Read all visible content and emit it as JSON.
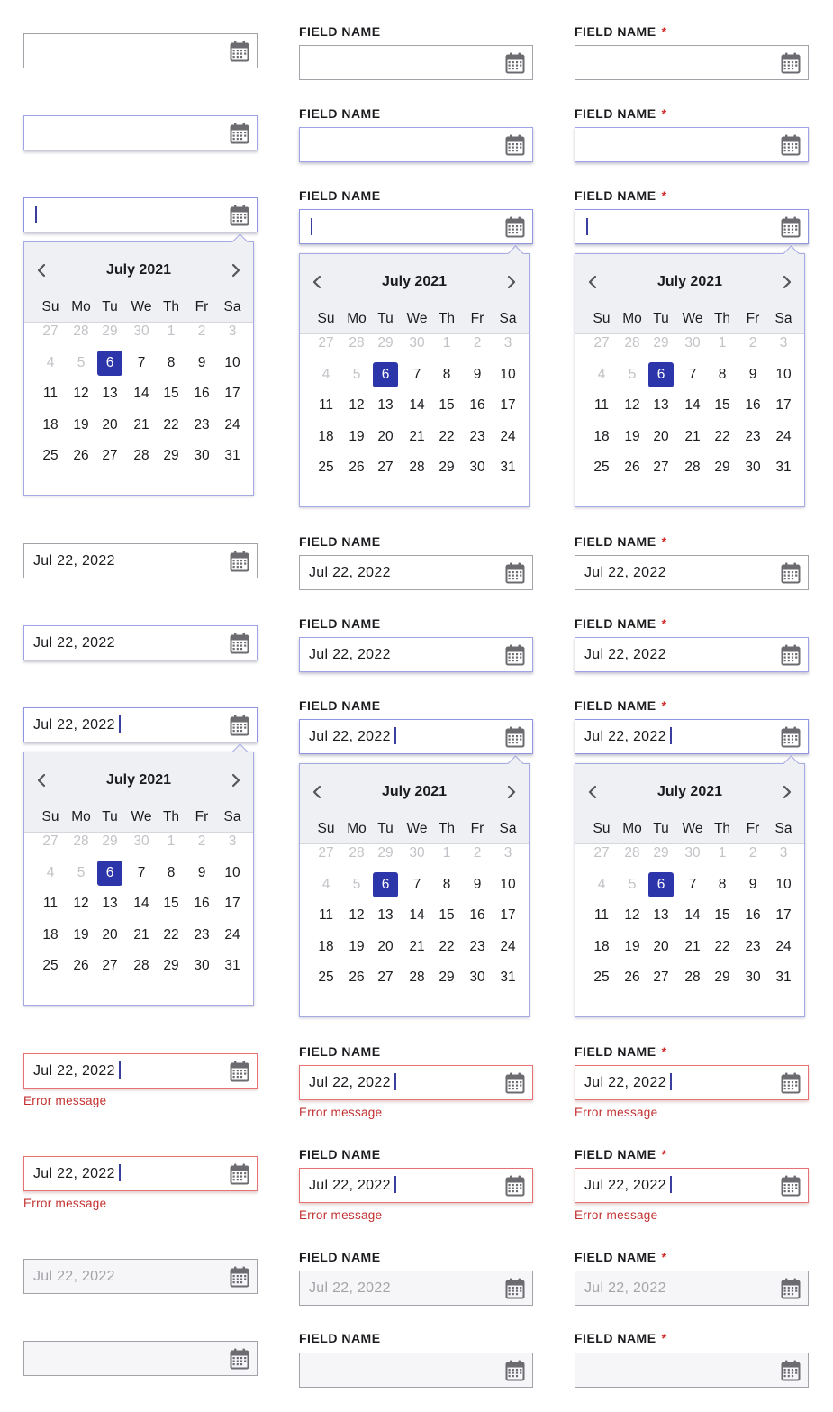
{
  "label": "FIELD NAME",
  "required_mark": "*",
  "date_value": "Jul 22, 2022",
  "error_message": "Error message",
  "calendar": {
    "month_label": "July 2021",
    "weekdays": [
      "Su",
      "Mo",
      "Tu",
      "We",
      "Th",
      "Fr",
      "Sa"
    ],
    "weeks": [
      [
        "27",
        "28",
        "29",
        "30",
        "1",
        "2",
        "3"
      ],
      [
        "4",
        "5",
        "6",
        "7",
        "8",
        "9",
        "10"
      ],
      [
        "11",
        "12",
        "13",
        "14",
        "15",
        "16",
        "17"
      ],
      [
        "18",
        "19",
        "20",
        "21",
        "22",
        "23",
        "24"
      ],
      [
        "25",
        "26",
        "27",
        "28",
        "29",
        "30",
        "31"
      ]
    ],
    "muted_days": [
      "27",
      "28",
      "29",
      "30",
      "1",
      "2",
      "3",
      "4",
      "5"
    ],
    "selected_day": "6"
  },
  "colors": {
    "accent": "#2d35ab",
    "focus_border": "#8f95e0",
    "error": "#c23030",
    "required": "#d62b2b",
    "disabled_bg": "#f6f6f8"
  },
  "icons": {
    "field": "calendar-icon",
    "prev": "chevron-left-icon",
    "next": "chevron-right-icon"
  },
  "rows": [
    {
      "state": "default",
      "value": "",
      "caret": false,
      "error": false,
      "picker": false
    },
    {
      "state": "hover",
      "value": "",
      "caret": false,
      "error": false,
      "picker": false
    },
    {
      "state": "focus",
      "value": "",
      "caret": true,
      "error": false,
      "picker": true
    },
    {
      "state": "filled",
      "value": "Jul 22, 2022",
      "caret": false,
      "error": false,
      "picker": false
    },
    {
      "state": "filled-hover",
      "value": "Jul 22, 2022",
      "caret": false,
      "error": false,
      "picker": false
    },
    {
      "state": "filled-focus",
      "value": "Jul 22, 2022",
      "caret": true,
      "error": false,
      "picker": true
    },
    {
      "state": "error",
      "value": "Jul 22, 2022",
      "caret": true,
      "error": true,
      "picker": false
    },
    {
      "state": "error-focus",
      "value": "Jul 22, 2022",
      "caret": true,
      "error": true,
      "picker": false
    },
    {
      "state": "disabled",
      "value": "Jul 22, 2022",
      "caret": false,
      "error": false,
      "picker": false
    },
    {
      "state": "disabled-empty",
      "value": "",
      "caret": false,
      "error": false,
      "picker": false
    }
  ],
  "columns": [
    "no-label",
    "label",
    "label-required"
  ]
}
